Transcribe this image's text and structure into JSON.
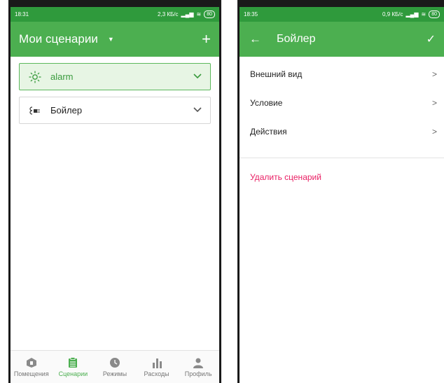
{
  "left": {
    "status": {
      "time": "18:31",
      "speed": "2,3 КБ/с",
      "battery": "80"
    },
    "appbar": {
      "title": "Мои сценарии"
    },
    "scenarios": [
      {
        "label": "alarm",
        "icon": "sun-icon"
      },
      {
        "label": "Бойлер",
        "icon": "plug-icon"
      }
    ],
    "nav": [
      {
        "label": "Помещения",
        "icon": "rooms-icon"
      },
      {
        "label": "Сценарии",
        "icon": "scenarios-icon"
      },
      {
        "label": "Режимы",
        "icon": "clock-icon"
      },
      {
        "label": "Расходы",
        "icon": "bar-chart-icon"
      },
      {
        "label": "Профиль",
        "icon": "person-icon"
      }
    ],
    "active_nav": "Сценарии"
  },
  "right": {
    "status": {
      "time": "18:35",
      "speed": "0,9 КБ/с",
      "battery": "80"
    },
    "appbar": {
      "title": "Бойлер"
    },
    "menu": [
      {
        "label": "Внешний вид"
      },
      {
        "label": "Условие"
      },
      {
        "label": "Действия"
      }
    ],
    "delete_label": "Удалить сценарий"
  },
  "colors": {
    "primary": "#4caf50",
    "status": "#2f9a3c",
    "accent": "#e91e63",
    "active_card_bg": "#e7f5e4"
  }
}
